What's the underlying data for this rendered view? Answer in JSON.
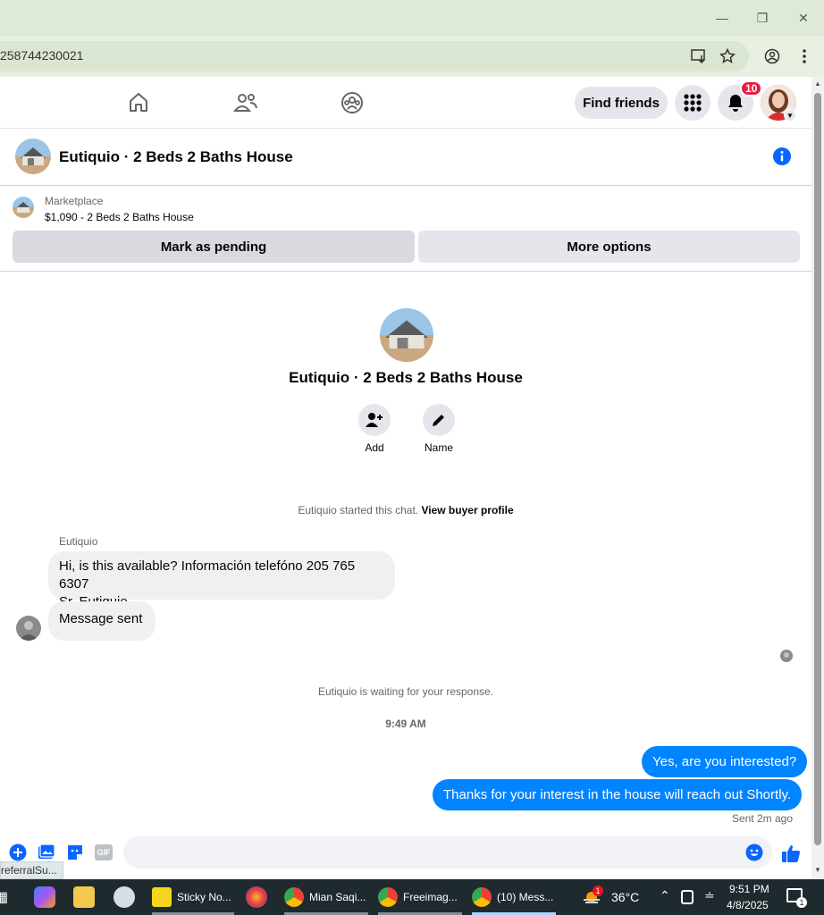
{
  "browser": {
    "url_fragment": "258744230021"
  },
  "nav": {
    "find_friends": "Find friends",
    "notification_count": "10"
  },
  "chat": {
    "title": "Eutiquio · 2 Beds 2 Baths House",
    "marketplace_label": "Marketplace",
    "listing": "$1,090 - 2 Beds 2 Baths House",
    "mark_pending": "Mark as pending",
    "more_options": "More options",
    "center_name": "Eutiquio · 2 Beds 2 Baths House",
    "add_label": "Add",
    "name_label": "Name",
    "started_text": "Eutiquio started this chat.",
    "view_buyer": "View buyer profile",
    "sender_name": "Eutiquio",
    "messages_in": [
      {
        "line1": "Hi, is this available? Información telefóno 205 765 6307",
        "line2": "Sr. Eutiquio"
      },
      {
        "line1": "Message sent"
      }
    ],
    "waiting_text": "Eutiquio is waiting for your response.",
    "timestamp": "9:49 AM",
    "messages_out": [
      "Yes, are you interested?",
      "Thanks for your interest in the house will reach out Shortly."
    ],
    "sent_status": "Sent 2m ago"
  },
  "composer": {
    "gif_label": "GIF",
    "status_tooltip": "referralSu..."
  },
  "taskbar": {
    "apps": [
      {
        "label": "Sticky No..."
      },
      {
        "label": "Mian Saqi..."
      },
      {
        "label": "Freeimag..."
      },
      {
        "label": "(10) Mess..."
      }
    ],
    "weather_temp": "36°C",
    "weather_badge": "1",
    "time": "9:51 PM",
    "date": "4/8/2025",
    "notif_count": "1"
  }
}
